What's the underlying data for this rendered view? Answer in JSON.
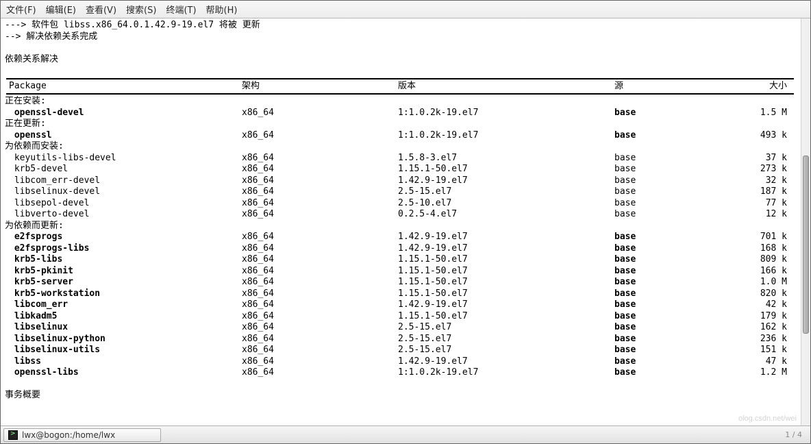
{
  "menubar": {
    "file": "文件(F)",
    "edit": "编辑(E)",
    "view": "查看(V)",
    "search": "搜索(S)",
    "terminal": "终端(T)",
    "help": "帮助(H)"
  },
  "intro": {
    "line1": "---> 软件包 libss.x86_64.0.1.42.9-19.el7 将被 更新",
    "line2": "--> 解决依赖关系完成",
    "line3": "依赖关系解决"
  },
  "headers": {
    "package": "Package",
    "arch": "架构",
    "version": "版本",
    "source": "源",
    "size": "大小"
  },
  "sections": {
    "installing": "正在安装:",
    "updating": "正在更新:",
    "dep_install": "为依赖而安装:",
    "dep_update": "为依赖而更新:"
  },
  "installing": [
    {
      "pkg": "openssl-devel",
      "arch": "x86_64",
      "ver": "1:1.0.2k-19.el7",
      "src": "base",
      "size": "1.5 M",
      "bold": true
    }
  ],
  "updating": [
    {
      "pkg": "openssl",
      "arch": "x86_64",
      "ver": "1:1.0.2k-19.el7",
      "src": "base",
      "size": "493 k",
      "bold": true
    }
  ],
  "dep_install": [
    {
      "pkg": "keyutils-libs-devel",
      "arch": "x86_64",
      "ver": "1.5.8-3.el7",
      "src": "base",
      "size": "37 k"
    },
    {
      "pkg": "krb5-devel",
      "arch": "x86_64",
      "ver": "1.15.1-50.el7",
      "src": "base",
      "size": "273 k"
    },
    {
      "pkg": "libcom_err-devel",
      "arch": "x86_64",
      "ver": "1.42.9-19.el7",
      "src": "base",
      "size": "32 k"
    },
    {
      "pkg": "libselinux-devel",
      "arch": "x86_64",
      "ver": "2.5-15.el7",
      "src": "base",
      "size": "187 k"
    },
    {
      "pkg": "libsepol-devel",
      "arch": "x86_64",
      "ver": "2.5-10.el7",
      "src": "base",
      "size": "77 k"
    },
    {
      "pkg": "libverto-devel",
      "arch": "x86_64",
      "ver": "0.2.5-4.el7",
      "src": "base",
      "size": "12 k"
    }
  ],
  "dep_update": [
    {
      "pkg": "e2fsprogs",
      "arch": "x86_64",
      "ver": "1.42.9-19.el7",
      "src": "base",
      "size": "701 k",
      "bold": true
    },
    {
      "pkg": "e2fsprogs-libs",
      "arch": "x86_64",
      "ver": "1.42.9-19.el7",
      "src": "base",
      "size": "168 k",
      "bold": true
    },
    {
      "pkg": "krb5-libs",
      "arch": "x86_64",
      "ver": "1.15.1-50.el7",
      "src": "base",
      "size": "809 k",
      "bold": true
    },
    {
      "pkg": "krb5-pkinit",
      "arch": "x86_64",
      "ver": "1.15.1-50.el7",
      "src": "base",
      "size": "166 k",
      "bold": true
    },
    {
      "pkg": "krb5-server",
      "arch": "x86_64",
      "ver": "1.15.1-50.el7",
      "src": "base",
      "size": "1.0 M",
      "bold": true
    },
    {
      "pkg": "krb5-workstation",
      "arch": "x86_64",
      "ver": "1.15.1-50.el7",
      "src": "base",
      "size": "820 k",
      "bold": true
    },
    {
      "pkg": "libcom_err",
      "arch": "x86_64",
      "ver": "1.42.9-19.el7",
      "src": "base",
      "size": "42 k",
      "bold": true
    },
    {
      "pkg": "libkadm5",
      "arch": "x86_64",
      "ver": "1.15.1-50.el7",
      "src": "base",
      "size": "179 k",
      "bold": true
    },
    {
      "pkg": "libselinux",
      "arch": "x86_64",
      "ver": "2.5-15.el7",
      "src": "base",
      "size": "162 k",
      "bold": true
    },
    {
      "pkg": "libselinux-python",
      "arch": "x86_64",
      "ver": "2.5-15.el7",
      "src": "base",
      "size": "236 k",
      "bold": true
    },
    {
      "pkg": "libselinux-utils",
      "arch": "x86_64",
      "ver": "2.5-15.el7",
      "src": "base",
      "size": "151 k",
      "bold": true
    },
    {
      "pkg": "libss",
      "arch": "x86_64",
      "ver": "1.42.9-19.el7",
      "src": "base",
      "size": "47 k",
      "bold": true
    },
    {
      "pkg": "openssl-libs",
      "arch": "x86_64",
      "ver": "1:1.0.2k-19.el7",
      "src": "base",
      "size": "1.2 M",
      "bold": true
    }
  ],
  "footer": {
    "summary": "事务概要"
  },
  "taskbar": {
    "button": "lwx@bogon:/home/lwx",
    "tray": "1 / 4"
  }
}
